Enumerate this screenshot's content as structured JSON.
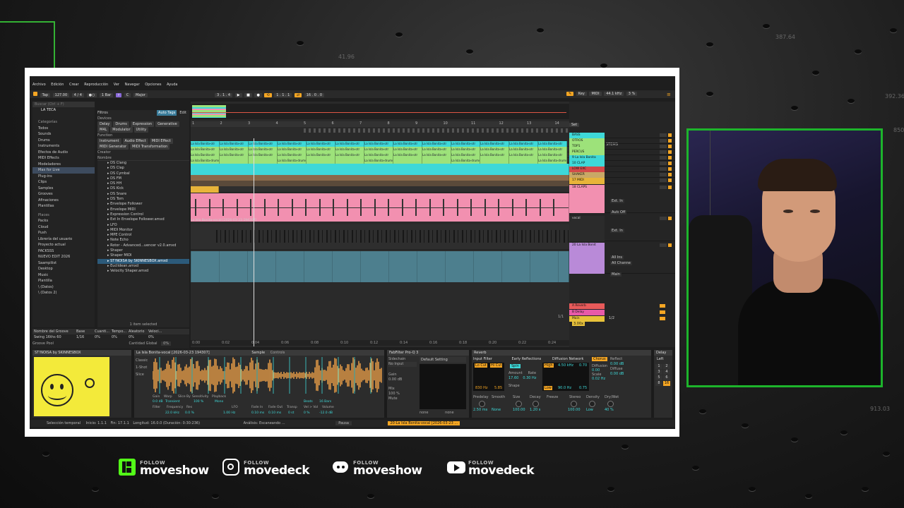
{
  "menu": [
    "Archivo",
    "Edición",
    "Crear",
    "Reproducción",
    "Ver",
    "Navegar",
    "Opciones",
    "Ayuda"
  ],
  "transport": {
    "tap": "Tap",
    "bpm": "127.00",
    "meter": "4 / 4",
    "bar": "1 Bar",
    "key": "C",
    "scale": "Major",
    "position": "3 .   1 .   4",
    "loop_start": "1 .   1 .   1",
    "loop_len": "16 .   0 .   0",
    "key_btn": "Key",
    "midi_btn": "MIDI",
    "sample_rate": "44.1 kHz",
    "cpu": "3 %"
  },
  "browser": {
    "search_placeholder": "Buscar (Ctrl + F)",
    "header": "LA TECA",
    "categories_title": "Categorías",
    "categories": [
      "Todos",
      "Sounds",
      "Drums",
      "Instruments",
      "Efectos de Audio",
      "MIDI Effects",
      "Modeladores",
      "Max for Live",
      "Plug-ins",
      "Clips",
      "Samples",
      "Grooves",
      "Afinaciones",
      "Plantillas"
    ],
    "places_title": "Places",
    "places": [
      "Packs",
      "Cloud",
      "Push",
      "Librería del usuario",
      "Proyecto actual",
      "PACKSSS",
      "NUEVO EDIT 2026",
      "Saampliist",
      "Desktop",
      "Music",
      "Plantilla",
      "\\ (Datos)",
      "\\ (Datos 2)"
    ],
    "filters_label": "Filtros",
    "auto_tags": "Auto Tags",
    "edit": "Edit",
    "devices_label": "Devices",
    "device_tags": [
      "Delay",
      "Drums",
      "Expression",
      "Generative",
      "M4L",
      "Modulator",
      "Utility"
    ],
    "function_label": "Function",
    "function_tags": [
      "Instrument",
      "Audio Effect",
      "MIDI Effect",
      "MIDI Generator",
      "MIDI Transformation"
    ],
    "creator_label": "Creator",
    "name_col": "Nombre",
    "items": [
      "DS Clang",
      "DS Clap",
      "DS Cymbal",
      "DS FM",
      "DS HH",
      "DS Kick",
      "DS Snare",
      "DS Tom",
      "Envelope Follower",
      "Envelope MIDI",
      "Expression Control",
      "Ext In Envelope Follower.amxd",
      "LFO",
      "MIDI Monitor",
      "MPE Control",
      "Note Echo",
      "Rotor - Advanced...uencer v2.0.amxd",
      "Shaper",
      "Shaper MIDI",
      "ST!NOISA by SKINNESBOX.amxd",
      "Euclidean.amxd",
      "Velocity Shaper.amxd"
    ],
    "selected_index": 19,
    "status": "1 item selected",
    "groove_cols": [
      "Nombre del Groove",
      "Base",
      "Cuanti...",
      "Tempo...",
      "Aleatorio",
      "Veloci..."
    ],
    "groove_row": [
      "Swing 16ths 60",
      "1/16",
      "0%",
      "0%",
      "0%",
      "0%"
    ],
    "groove_pool": "Groove Pool",
    "global_amount_label": "Cantidad Global",
    "global_amount": "0%"
  },
  "arrangement": {
    "ruler": [
      "1",
      "2",
      "3",
      "4",
      "5",
      "6",
      "7",
      "8",
      "9",
      "10",
      "11",
      "12",
      "13",
      "14"
    ],
    "time": [
      "0:00",
      "0:02",
      "0:04",
      "0:06",
      "0:08",
      "0:10",
      "0:12",
      "0:14",
      "0:16",
      "0:18",
      "0:20",
      "0:22",
      "0:24"
    ],
    "clip_label_other": "La Isla Bonita-otr",
    "clip_label_drums": "La Isla Bonita-drums [2026-03-23 210736]",
    "vocal_clip": "La Isla Bonita-vocal [2026-03-23 194307]",
    "tracks": [
      {
        "name": "BASS",
        "color": "#3ed8d8"
      },
      {
        "name": "OTROS",
        "color": "#9de27a"
      },
      {
        "name": "TOP1",
        "color": "#9de27a"
      },
      {
        "name": "PERCUS",
        "color": "#9de27a"
      },
      {
        "name": "9 La Isla Bonita",
        "color": "#3ed8d8"
      },
      {
        "name": "10 CLAP",
        "color": "#3ed8d8"
      },
      {
        "name": "LOW EXC",
        "color": "#d34a4a"
      },
      {
        "name": "SHAKER",
        "color": "#c9a866"
      },
      {
        "name": "17 MIDI",
        "color": "#e8b43a"
      },
      {
        "name": "18 CLAPS",
        "color": "#f290b0"
      },
      {
        "name": "vocal",
        "color": "#2b2b2b"
      },
      {
        "name": "20 La Isla Bonit",
        "color": "#b98ad8"
      }
    ],
    "returns": [
      {
        "name": "A Reverb",
        "color": "#e85a5a"
      },
      {
        "name": "B Delay",
        "color": "#e85aa8"
      },
      {
        "name": "Main",
        "color": "#e8c23a"
      }
    ],
    "set_btn": "Set",
    "stems_label": "STEMS",
    "ext_in": "Ext. In",
    "auto": "Auto",
    "off": "Off",
    "all_ins": "All Ins",
    "all_channels": "All Channe",
    "main": "Main",
    "page": "1/1",
    "tempo_out": "3.00x",
    "fraction": "1/2"
  },
  "devices": {
    "m4l_title": "ST!NOISA by SKINNESBOX",
    "sampler_title": "La Isla Bonita-vocal [2026-03-23 194307]",
    "sample_tab": "Sample",
    "controls_tab": "Controls",
    "sampler_labels": [
      "Classic",
      "1-Shot",
      "Slice",
      "Gain",
      "Warp",
      "Slice By",
      "Sensitivity",
      "Playback",
      "Transient",
      "Mono",
      "Beats",
      "16 Bars",
      "Filter",
      "Frequency",
      "Res",
      "LFO",
      "Fade In",
      "Fade Out",
      "Transp",
      "Vel > Vol",
      "Volume"
    ],
    "sampler_values": [
      "0.0 dB",
      "Transient",
      "100 %",
      "Mono",
      "Beats",
      "16 Bars",
      "22.0 kHz",
      "0.0 %",
      "1.00 Hz",
      "0.10 ms",
      "0.10 ms",
      "0 st",
      "0 %",
      "-12.0 dB"
    ],
    "fab_title": "FabFilter Pro-Q 3",
    "sidechain": "Sidechain",
    "no_input": "No Input",
    "gain": "Gain",
    "gain_val": "0.00 dB",
    "mix": "Mix",
    "mix_val": "100 %",
    "mute": "Mute",
    "default_setting": "Default Setting",
    "none1": "none",
    "none2": "none",
    "reverb_title": "Reverb",
    "input_filter": "Input Filter",
    "early": "Early Reflections",
    "diffusion": "Diffusion Network",
    "reverb_vals": [
      "Lo Cut",
      "Hi Cut",
      "830 Hz",
      "5.85",
      "Spin",
      "17.60",
      "0.30 Hz",
      "High",
      "4.50 kHz",
      "0.70",
      "Low",
      "90.0 Hz",
      "0.75",
      "Chorus",
      "0.00",
      "0.02 Hz",
      "0.00 dB",
      "0.00 dB"
    ],
    "reverb_labels": [
      "Amount",
      "Rate",
      "Shape",
      "Diffusion",
      "Scale",
      "Predelay",
      "Smooth",
      "Size",
      "Decay",
      "Freeze",
      "Flat",
      "Cut",
      "Stereo",
      "Density",
      "Dry/Wet",
      "Reflect",
      "Diffuse"
    ],
    "reverb_bottom": [
      "2.50 ms",
      "None",
      "100.00",
      "1.20 s",
      "100.00",
      "Low",
      "40 %"
    ],
    "delay_title": "Delay",
    "delay_left": "Left",
    "delay_grid": [
      "1",
      "2",
      "3",
      "4",
      "5",
      "6",
      "8",
      "16"
    ]
  },
  "status_bar": {
    "selection": "Selección temporal",
    "start": "Inicio: 1.1.1",
    "end": "Fin: 17.1.1",
    "length": "Longitud: 16.0.0 (Duración: 0:30:236)",
    "analysis": "Análisis: Escaneando ...",
    "pause": "Pausa",
    "track": "20-La Isla Bonita-vocal [2026-03-23 ..."
  },
  "background": {
    "numbers": [
      "41.96",
      "387.64",
      "392.36",
      "850.36",
      "913.03"
    ]
  },
  "socials": [
    {
      "icon": "kick-icon",
      "small": "FOLLOW",
      "big": "moveshow",
      "color": "#53fc18"
    },
    {
      "icon": "instagram-icon",
      "small": "FOLLOW",
      "big": "movedeck",
      "color": "#ffffff"
    },
    {
      "icon": "discord-icon",
      "small": "FOLLOW",
      "big": "moveshow",
      "color": "#ffffff"
    },
    {
      "icon": "youtube-icon",
      "small": "FOLLOW",
      "big": "movedeck",
      "color": "#ffffff"
    }
  ],
  "colors": {
    "accent": "#1db42b",
    "ableton_orange": "#f5a623",
    "sampler_wave": "#f5a54a"
  }
}
